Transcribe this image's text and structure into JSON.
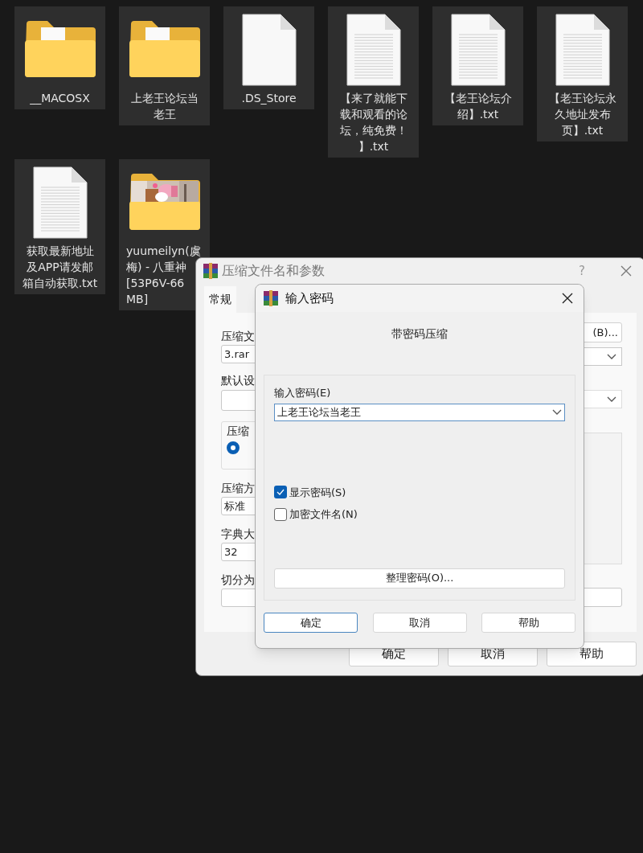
{
  "desktop_items": [
    {
      "kind": "folder",
      "lines": [
        "__MACOSX"
      ]
    },
    {
      "kind": "folder",
      "lines": [
        "上老王论坛当",
        "老王"
      ]
    },
    {
      "kind": "file",
      "lines": [
        ".DS_Store"
      ]
    },
    {
      "kind": "txt",
      "lines": [
        "【来了就能下",
        "载和观看的论",
        "坛，纯免费！",
        "】.txt"
      ]
    },
    {
      "kind": "txt",
      "lines": [
        "【老王论坛介",
        "绍】.txt"
      ]
    },
    {
      "kind": "txt",
      "lines": [
        "【老王论坛永",
        "久地址发布",
        "页】.txt"
      ]
    },
    {
      "kind": "txt",
      "lines": [
        "获取最新地址",
        "及APP请发邮",
        "箱自动获取.txt"
      ]
    },
    {
      "kind": "photo-folder",
      "lines": [
        "yuumeilyn(虞",
        "梅) - 八重神",
        "[53P6V-66",
        "MB]"
      ]
    }
  ],
  "archive_dialog": {
    "title": "压缩文件名和参数",
    "help": "?",
    "tab": "常规",
    "archive_label": "压缩文",
    "archive_value": "3.rar",
    "profile_label": "默认设",
    "format_group_label": "压缩",
    "format_radio_selected": true,
    "method_label": "压缩方",
    "method_value": "标准",
    "dict_label": "字典大",
    "dict_value": "32",
    "split_label": "切分为",
    "browse_button": "(B)...",
    "buttons": [
      "确定",
      "取消",
      "帮助"
    ]
  },
  "password_dialog": {
    "title": "输入密码",
    "heading": "带密码压缩",
    "password_label": "输入密码(E)",
    "password_value": "上老王论坛当老王",
    "options": [
      {
        "label": "显示密码(S)",
        "checked": true
      },
      {
        "label": "加密文件名(N)",
        "checked": false
      }
    ],
    "organize_button": "整理密码(O)...",
    "buttons": [
      {
        "label": "确定",
        "default": true
      },
      {
        "label": "取消",
        "default": false
      },
      {
        "label": "帮助",
        "default": false
      }
    ]
  }
}
